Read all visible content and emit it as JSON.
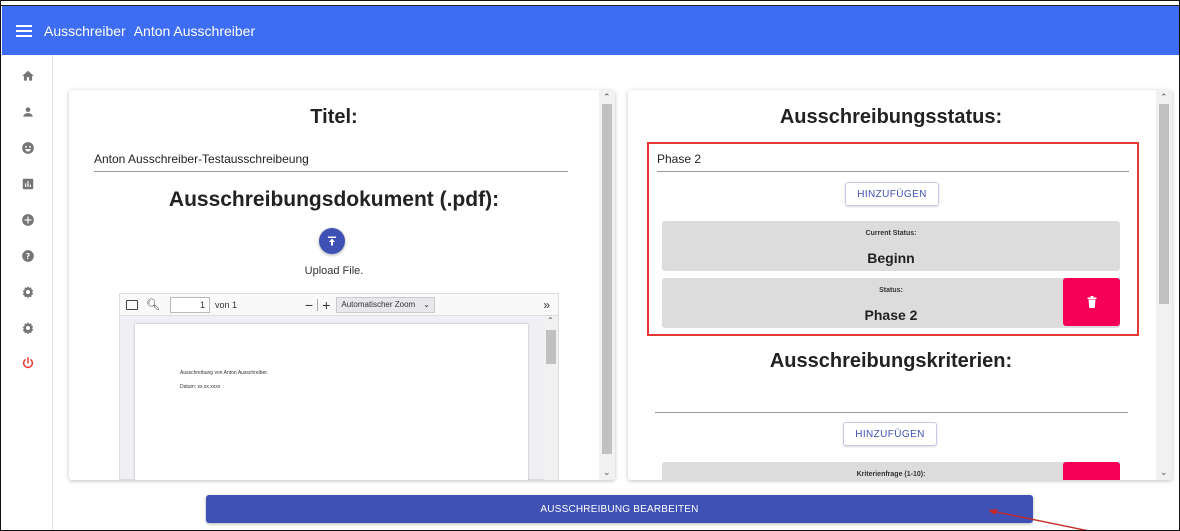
{
  "header": {
    "title": "Ausschreiber",
    "user": "Anton Ausschreiber",
    "accent": "#3d6cf5"
  },
  "sidebar": {
    "items": [
      {
        "icon": "home-icon"
      },
      {
        "icon": "person-icon"
      },
      {
        "icon": "group-icon"
      },
      {
        "icon": "chart-icon"
      },
      {
        "icon": "add-circle-icon"
      },
      {
        "icon": "help-icon"
      },
      {
        "icon": "settings-icon"
      },
      {
        "icon": "settings-icon"
      },
      {
        "icon": "power-icon",
        "color": "#e53935"
      }
    ]
  },
  "left_card": {
    "title_heading": "Titel:",
    "title_value": "Anton Ausschreiber-Testausschreibeung",
    "doc_heading": "Ausschreibungsdokument (.pdf):",
    "upload_label": "Upload File.",
    "pdf": {
      "page_value": "1",
      "page_total": "von 1",
      "zoom": "Automatischer Zoom",
      "line1": "Ausschreibung von Anton Ausschreiber.",
      "line2": "Datum: xx.xx.xxxx"
    }
  },
  "right_card": {
    "status_heading": "Ausschreibungsstatus:",
    "status_input_value": "Phase 2",
    "add_button": "HINZUFÜGEN",
    "current_status_label": "Current Status:",
    "current_status_value": "Beginn",
    "status_label": "Status:",
    "status_value": "Phase 2",
    "criteria_heading": "Ausschreibungskriterien:",
    "criteria_add_button": "HINZUFÜGEN",
    "criteria_question_label": "Kriterienfrage (1-10):"
  },
  "footer": {
    "edit_button": "AUSSCHREIBUNG BEARBEITEN"
  },
  "colors": {
    "primary": "#3f51b5",
    "delete": "#f50057",
    "highlight": "#e53935"
  }
}
